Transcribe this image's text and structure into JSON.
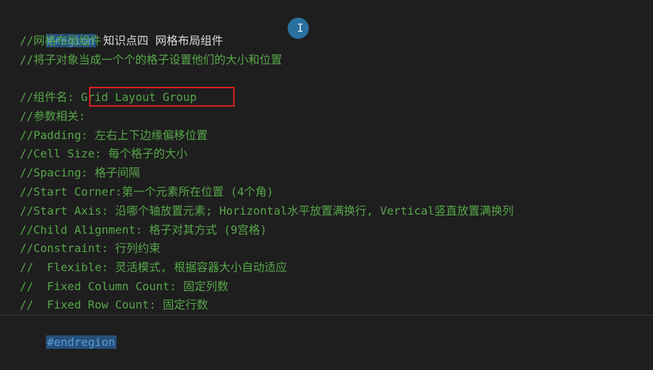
{
  "editor": {
    "region_keyword": "#region",
    "region_title": "知识点四 网格布局组件",
    "lines": [
      "//网格布局组件",
      "//将子对象当成一个个的格子设置他们的大小和位置",
      "",
      "//组件名: Grid Layout Group",
      "//参数相关:",
      "//Padding: 左右上下边缘偏移位置",
      "//Cell Size: 每个格子的大小",
      "//Spacing: 格子间隔",
      "//Start Corner:第一个元素所在位置 (4个角)",
      "//Start Axis: 沿哪个轴放置元素; Horizontal水平放置满换行, Vertical竖直放置满换列",
      "//Child Alignment: 格子对其方式 (9宫格)",
      "//Constraint: 行列约束",
      "//  Flexible: 灵活模式, 根据容器大小自动适应",
      "//  Fixed Column Count: 固定列数",
      "//  Fixed Row Count: 固定行数"
    ],
    "endregion_keyword": "#endregion"
  },
  "cursor": {
    "icon": "text-cursor-icon",
    "glyph": "I"
  },
  "colors": {
    "background": "#1e1e1e",
    "comment": "#57a64a",
    "keyword": "#569cd6",
    "selection": "#264f78",
    "highlight_box": "#e02020"
  }
}
